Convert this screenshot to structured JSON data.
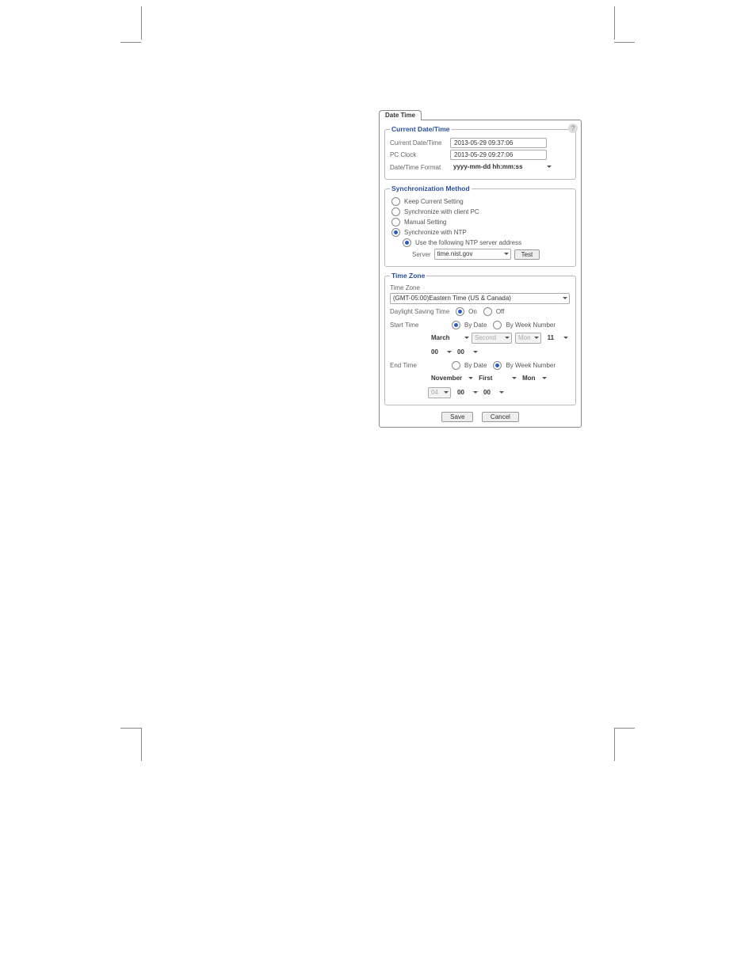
{
  "tab_label": "Date Time",
  "help_icon": "?",
  "current": {
    "legend": "Current Date/Time",
    "rows": {
      "current_label": "Current Date/Time",
      "current_value": "2013-05-29   09:37:06",
      "pc_label": "PC Clock",
      "pc_value": "2013-05-29   09:27:06",
      "fmt_label": "Date/Time Format",
      "fmt_value": "yyyy-mm-dd hh:mm:ss"
    }
  },
  "sync": {
    "legend": "Synchronization Method",
    "keep": "Keep Current Setting",
    "client": "Synchronize with client PC",
    "manual": "Manual Setting",
    "ntp": "Synchronize with NTP",
    "use_addr": "Use the following NTP server address",
    "server_label": "Server",
    "server_value": "time.nist.gov",
    "test": "Test"
  },
  "tz": {
    "legend": "Time Zone",
    "tz_label": "Time Zone",
    "tz_value": "(GMT-05:00)Eastern Time (US & Canada)",
    "dst_label": "Daylight Saving Time",
    "on": "On",
    "off": "Off",
    "start_label": "Start Time",
    "end_label": "End Time",
    "by_date": "By Date",
    "by_week": "By Week Number",
    "start": {
      "month": "March",
      "ord": "Second",
      "dow": "Mon",
      "day": "11",
      "hh": "00",
      "mm": "00"
    },
    "end": {
      "month": "November",
      "ord": "First",
      "dow": "Mon",
      "day": "04",
      "hh": "00",
      "mm": "00"
    }
  },
  "buttons": {
    "save": "Save",
    "cancel": "Cancel"
  }
}
